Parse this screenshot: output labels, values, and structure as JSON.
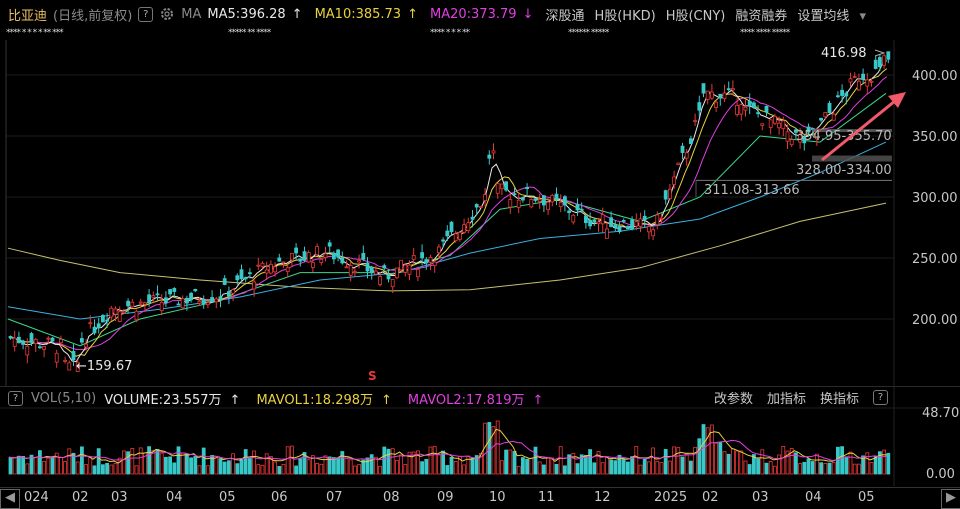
{
  "header": {
    "stock_name": "比亚迪",
    "mode": "(日线,前复权)",
    "question": "?",
    "ma_label": "MA",
    "ma5": "MA5:396.28",
    "ma10": "MA10:385.73",
    "ma20": "MA20:373.79",
    "arrow_up": "↑",
    "arrow_down": "↓",
    "tabs": [
      "深股通",
      "H股(HKD)",
      "H股(CNY)",
      "融资融券",
      "设置均线"
    ],
    "dropdown": "▾"
  },
  "masked_text": [
    "**** * * * * ** ***",
    "***** ** ****",
    "**** * * * **",
    "****** *****",
    "**** **** *****"
  ],
  "price_axis": [
    "400.00",
    "350.00",
    "300.00",
    "250.00",
    "200.00"
  ],
  "annotations": {
    "high": "416.98",
    "low": "←159.67",
    "zone1": "354.95-355.70",
    "zone2": "328.00-334.00",
    "zone3": "311.08-313.66",
    "event_marker": "S"
  },
  "volume_header": {
    "vol_label": "VOL(5,10)",
    "volume": "VOLUME:23.557万",
    "mavol1": "MAVOL1:18.298万",
    "mavol2": "MAVOL2:17.819万",
    "tools": [
      "改参数",
      "加指标",
      "换指标"
    ],
    "vol_axis_top": "48.70",
    "vol_axis_bottom": "0.00"
  },
  "x_axis": [
    "024",
    "02",
    "03",
    "04",
    "05",
    "06",
    "07",
    "08",
    "09",
    "10",
    "11",
    "12",
    "2025",
    "02",
    "03",
    "04",
    "05"
  ],
  "colors": {
    "up": "#e83838",
    "down": "#39c8c8",
    "ma5": "#e8e8e8",
    "ma10": "#e8d23c",
    "ma20": "#e040e0",
    "ma60": "#3cd88c",
    "ma120": "#3cb0e0",
    "ma250": "#c8c070",
    "annotation_arrow": "#f05a6a"
  },
  "chart_data": {
    "type": "candlestick",
    "title": "比亚迪 (日线,前复权)",
    "ylim": [
      150,
      430
    ],
    "y_ticks": [
      200,
      250,
      300,
      350,
      400
    ],
    "months": [
      "2024-01",
      "2024-02",
      "2024-03",
      "2024-04",
      "2024-05",
      "2024-06",
      "2024-07",
      "2024-08",
      "2024-09",
      "2024-10",
      "2024-11",
      "2024-12",
      "2025-01",
      "2025-02",
      "2025-03",
      "2025-04",
      "2025-05"
    ],
    "approx_close_by_month": [
      185,
      175,
      210,
      215,
      220,
      245,
      255,
      235,
      255,
      305,
      300,
      280,
      275,
      375,
      370,
      345,
      400
    ],
    "period_high": 416.98,
    "period_low": 159.67,
    "ma_latest": {
      "MA5": 396.28,
      "MA10": 385.73,
      "MA20": 373.79
    },
    "volume_latest_wan": 23.557,
    "mavol1_wan": 18.298,
    "mavol2_wan": 17.819,
    "volume_axis_max": 48.7
  }
}
